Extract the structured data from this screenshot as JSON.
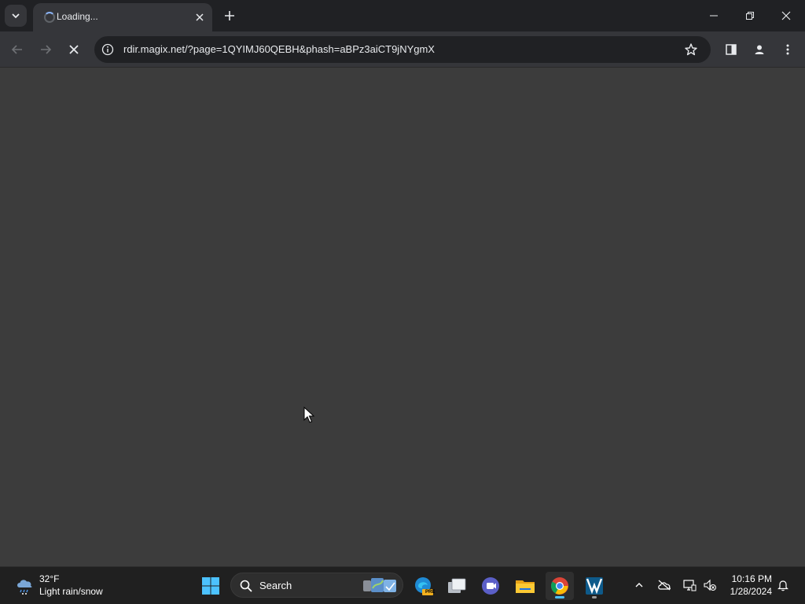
{
  "browser": {
    "tab": {
      "title": "Loading..."
    },
    "omnibox": {
      "url": "rdir.magix.net/?page=1QYIMJ60QEBH&phash=aBPz3aiCT9jNYgmX"
    },
    "accent_color": "#8ab4f8"
  },
  "taskbar": {
    "weather": {
      "temp": "32°F",
      "condition": "Light rain/snow"
    },
    "search": {
      "label": "Search"
    },
    "apps": [
      "edge-pre-icon",
      "task-view-icon",
      "teams-icon",
      "file-explorer-icon",
      "chrome-icon",
      "vscode-icon"
    ],
    "clock": {
      "time": "10:16 PM",
      "date": "1/28/2024"
    },
    "edge_badge": "PRE"
  }
}
